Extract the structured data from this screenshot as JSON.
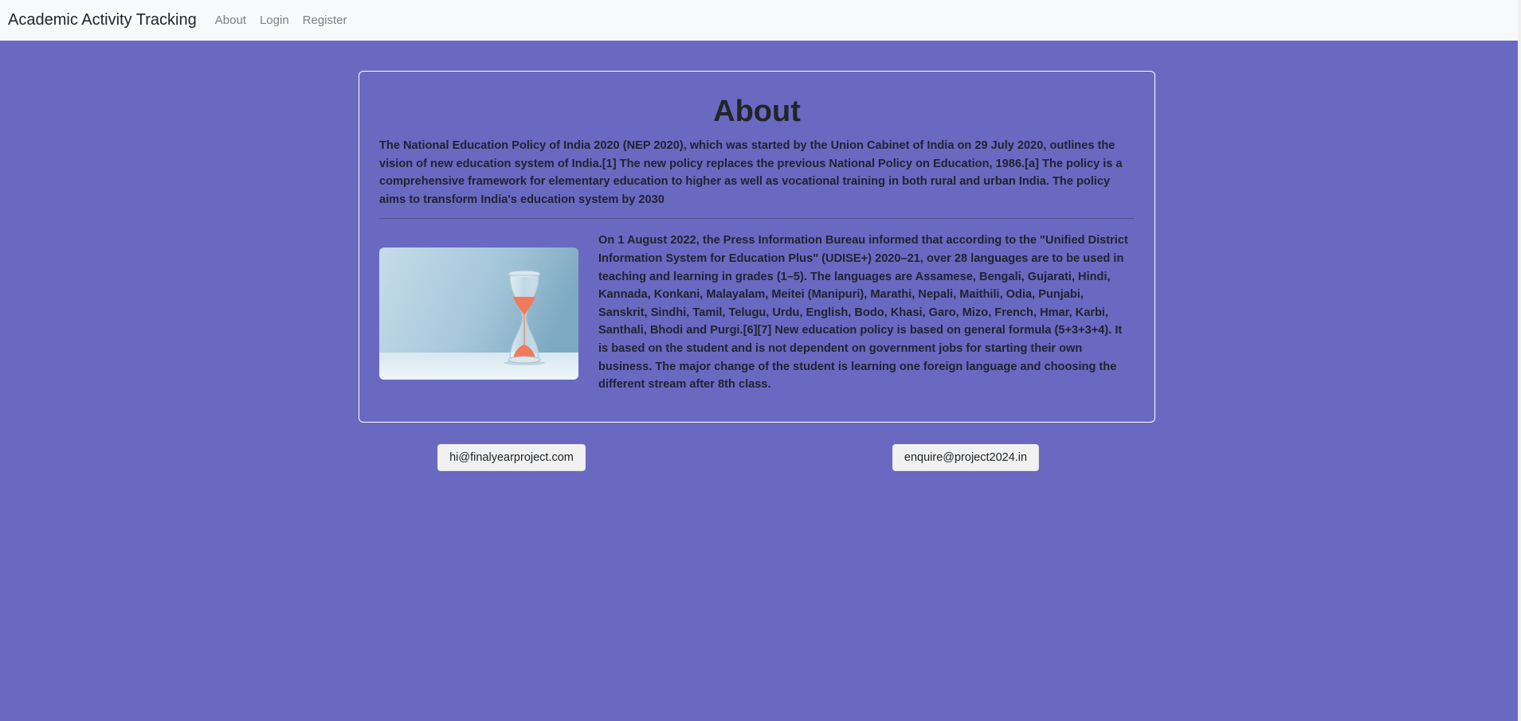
{
  "navbar": {
    "brand": "Academic Activity Tracking",
    "links": [
      "About",
      "Login",
      "Register"
    ]
  },
  "card": {
    "title": "About",
    "intro": "The National Education Policy of India 2020 (NEP 2020), which was started by the Union Cabinet of India on 29 July 2020, outlines the vision of new education system of India.[1] The new policy replaces the previous National Policy on Education, 1986.[a] The policy is a comprehensive framework for elementary education to higher as well as vocational training in both rural and urban India. The policy aims to transform India's education system by 2030",
    "detail": "On 1 August 2022, the Press Information Bureau informed that according to the \"Unified District Information System for Education Plus\" (UDISE+) 2020–21, over 28 languages are to be used in teaching and learning in grades (1–5). The languages are Assamese, Bengali, Gujarati, Hindi, Kannada, Konkani, Malayalam, Meitei (Manipuri), Marathi, Nepali, Maithili, Odia, Punjabi, Sanskrit, Sindhi, Tamil, Telugu, Urdu, English, Bodo, Khasi, Garo, Mizo, French, Hmar, Karbi, Santhali, Bhodi and Purgi.[6][7] New education policy is based on general formula (5+3+3+4). It is based on the student and is not dependent on government jobs for starting their own business. The major change of the student is learning one foreign language and choosing the different stream after 8th class.",
    "image_icon": "hourglass-image"
  },
  "contacts": {
    "left": "hi@finalyearproject.com",
    "right": "enquire@project2024.in"
  },
  "colors": {
    "background": "#6a69c1",
    "navbar": "#f8f9fa",
    "card_border": "#ffffff",
    "button_bg": "#f1f1f1",
    "sand": "#f07a5a"
  }
}
